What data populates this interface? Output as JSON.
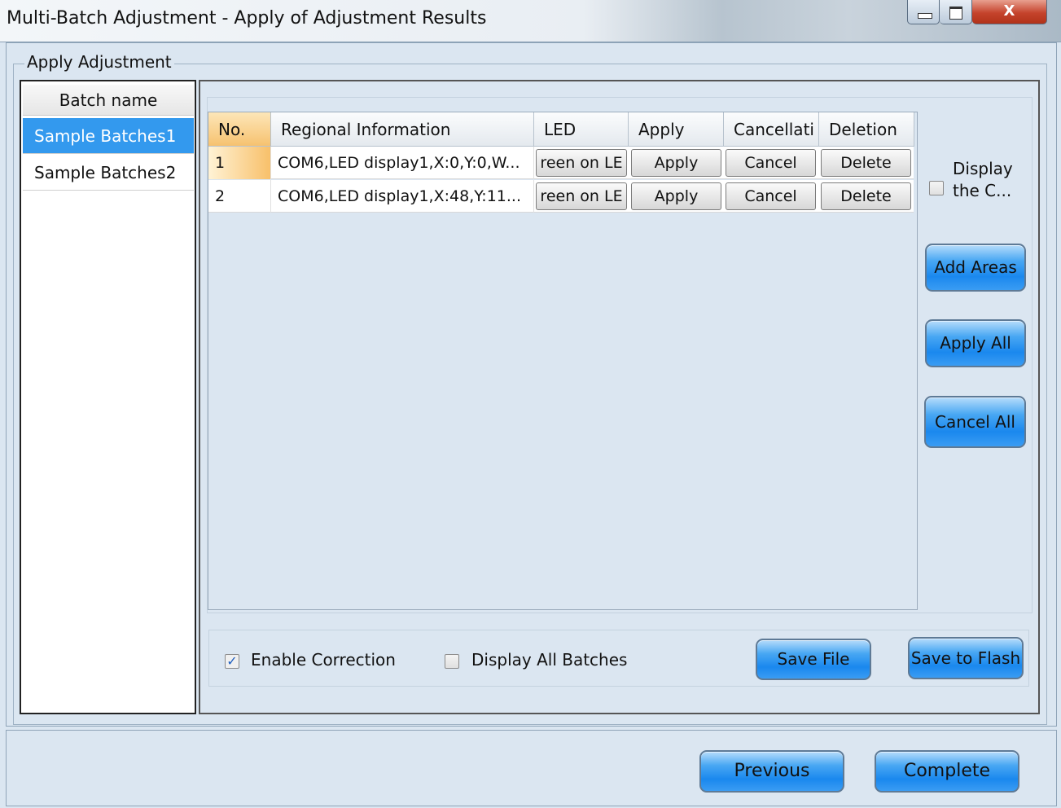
{
  "window": {
    "title": "Multi-Batch Adjustment - Apply of Adjustment Results",
    "close_glyph": "X"
  },
  "group_label": "Apply Adjustment",
  "batch_list": {
    "header": "Batch name",
    "items": [
      {
        "label": "Sample Batches1",
        "selected": true
      },
      {
        "label": "Sample Batches2",
        "selected": false
      }
    ]
  },
  "table": {
    "columns": [
      "No.",
      "Regional Information",
      "LED",
      "Apply",
      "Cancellati",
      "Deletion"
    ],
    "rows": [
      {
        "no": "1",
        "region": "COM6,LED display1,X:0,Y:0,W...",
        "led": "reen on LE",
        "apply": "Apply",
        "cancel": "Cancel",
        "delete": "Delete"
      },
      {
        "no": "2",
        "region": "COM6,LED display1,X:48,Y:11...",
        "led": "reen on LE",
        "apply": "Apply",
        "cancel": "Cancel",
        "delete": "Delete"
      }
    ]
  },
  "side": {
    "display_checkbox_label_line1": "Display",
    "display_checkbox_label_line2": "the C...",
    "display_checked": false,
    "add_areas": "Add Areas",
    "apply_all": "Apply All",
    "cancel_all": "Cancel All"
  },
  "options": {
    "enable_correction": "Enable Correction",
    "enable_correction_checked": true,
    "display_all_batches": "Display All Batches",
    "display_all_batches_checked": false,
    "save_file": "Save File",
    "save_to_flash": "Save to Flash"
  },
  "footer": {
    "previous": "Previous",
    "complete": "Complete"
  },
  "colors": {
    "accent_blue": "#1a88ee",
    "selection": "#3399ee",
    "background": "#dbe6f1",
    "close_red": "#c5432c"
  },
  "icons": {
    "minimize": "minimize-icon",
    "maximize": "maximize-icon",
    "close": "close-icon",
    "checkmark": "checkmark-icon"
  }
}
